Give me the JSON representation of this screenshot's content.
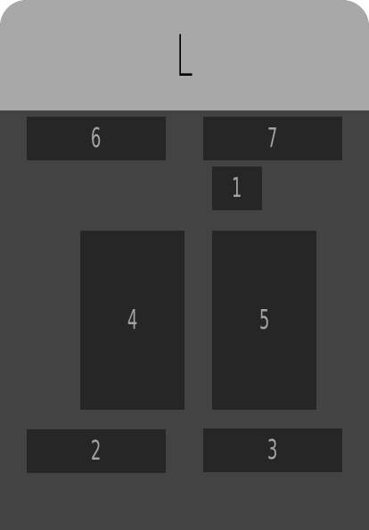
{
  "header": {
    "letter": "L"
  },
  "slots": {
    "s1": "1",
    "s2": "2",
    "s3": "3",
    "s4": "4",
    "s5": "5",
    "s6": "6",
    "s7": "7"
  },
  "colors": {
    "header_bg": "#a8a8a8",
    "body_bg": "#434343",
    "slot_bg": "#262626",
    "slot_text": "#a3a3a3",
    "header_text": "#000000"
  }
}
